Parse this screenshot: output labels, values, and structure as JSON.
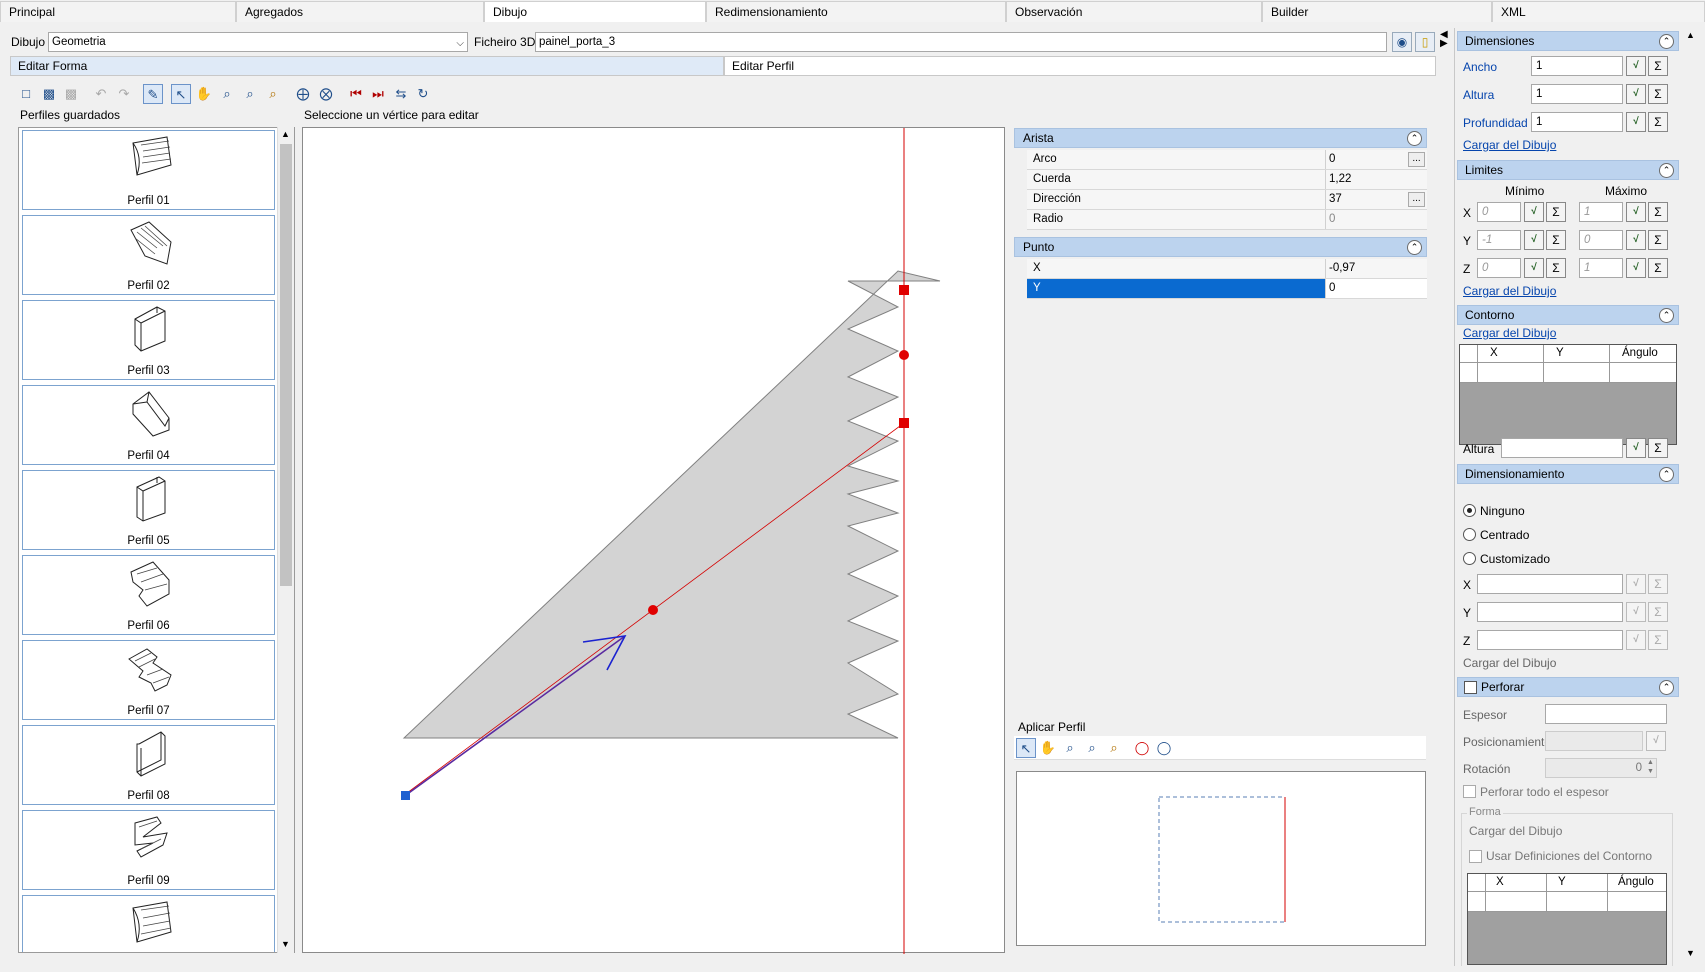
{
  "tabs": [
    "Principal",
    "Agregados",
    "Dibujo",
    "Redimensionamiento",
    "Observación",
    "Builder",
    "XML"
  ],
  "dibujo": {
    "label": "Dibujo",
    "value": "Geometria",
    "fichero_label": "Ficheiro 3D",
    "fichero_value": "painel_porta_3"
  },
  "inner_tabs": [
    "Editar Forma",
    "Editar Perfil"
  ],
  "perfiles_label": "Perfiles guardados",
  "canvas_hint": "Seleccione un vértice para editar",
  "perfiles": [
    "Perfil 01",
    "Perfil 02",
    "Perfil 03",
    "Perfil 04",
    "Perfil 05",
    "Perfil 06",
    "Perfil 07",
    "Perfil 08",
    "Perfil 09"
  ],
  "arista": {
    "title": "Arista",
    "rows": [
      {
        "name": "Arco",
        "value": "0"
      },
      {
        "name": "Cuerda",
        "value": "1,22"
      },
      {
        "name": "Dirección",
        "value": "37"
      },
      {
        "name": "Radio",
        "value": "0"
      }
    ]
  },
  "punto": {
    "title": "Punto",
    "rows": [
      {
        "name": "X",
        "value": "-0,97"
      },
      {
        "name": "Y",
        "value": "0"
      }
    ]
  },
  "aplicar_perfil": "Aplicar Perfil",
  "dimensiones": {
    "title": "Dimensiones",
    "ancho_label": "Ancho",
    "ancho": "1",
    "altura_label": "Altura",
    "altura": "1",
    "prof_label": "Profundidad",
    "prof": "1",
    "cargar": "Cargar del Dibujo"
  },
  "limites": {
    "title": "Limites",
    "min_label": "Mínimo",
    "max_label": "Máximo",
    "x_label": "X",
    "x_min": "0",
    "x_max": "1",
    "y_label": "Y",
    "y_min": "-1",
    "y_max": "0",
    "z_label": "Z",
    "z_min": "0",
    "z_max": "1",
    "cargar": "Cargar del Dibujo"
  },
  "contorno": {
    "title": "Contorno",
    "cargar": "Cargar del Dibujo",
    "cols": [
      "X",
      "Y",
      "Ángulo"
    ],
    "altura_label": "Altura"
  },
  "dimensionamiento": {
    "title": "Dimensionamiento",
    "opt1": "Ninguno",
    "opt2": "Centrado",
    "opt3": "Customizado",
    "x": "X",
    "y": "Y",
    "z": "Z",
    "cargar": "Cargar del Dibujo"
  },
  "perforar": {
    "title": "Perforar",
    "espesor": "Espesor",
    "posicionamiento": "Posicionamiento",
    "rotacion": "Rotación",
    "rotacion_value": "0",
    "todo": "Perforar todo el espesor",
    "forma": "Forma",
    "cargar": "Cargar del Dibujo",
    "usar": "Usar Definiciones del Contorno",
    "cols": [
      "X",
      "Y",
      "Ángulo"
    ]
  }
}
